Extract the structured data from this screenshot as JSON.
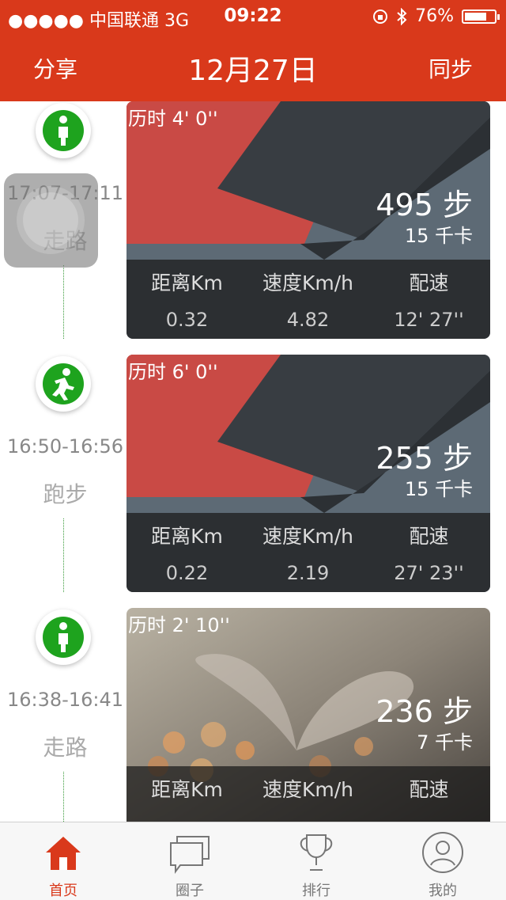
{
  "status": {
    "carrier": "●●●●● 中国联通 3G",
    "time": "09:22",
    "battery": "76%",
    "battery_level": 0.76
  },
  "header": {
    "share": "分享",
    "title": "12月27日",
    "sync": "同步"
  },
  "activities": [
    {
      "icon": "walking-icon",
      "time_range": "17:07-17:11",
      "type": "走路",
      "duration": "历时 4' 0''",
      "steps": "495 步",
      "calories": "15 千卡",
      "stat_headers": [
        "距离Km",
        "速度Km/h",
        "配速"
      ],
      "stat_values": [
        "0.32",
        "4.82",
        "12' 27''"
      ]
    },
    {
      "icon": "running-icon",
      "time_range": "16:50-16:56",
      "type": "跑步",
      "duration": "历时 6' 0''",
      "steps": "255 步",
      "calories": "15 千卡",
      "stat_headers": [
        "距离Km",
        "速度Km/h",
        "配速"
      ],
      "stat_values": [
        "0.22",
        "2.19",
        "27' 23''"
      ]
    },
    {
      "icon": "walking-icon",
      "time_range": "16:38-16:41",
      "type": "走路",
      "duration": "历时 2' 10''",
      "steps": "236 步",
      "calories": "7 千卡",
      "stat_headers": [
        "距离Km",
        "速度Km/h",
        "配速"
      ],
      "stat_values": [
        "",
        "",
        ""
      ]
    }
  ],
  "tabs": [
    {
      "label": "首页",
      "icon": "home-icon",
      "active": true
    },
    {
      "label": "圈子",
      "icon": "chat-icon",
      "active": false
    },
    {
      "label": "排行",
      "icon": "trophy-icon",
      "active": false
    },
    {
      "label": "我的",
      "icon": "profile-icon",
      "active": false
    }
  ],
  "colors": {
    "accent": "#d9391b",
    "activity_green": "#1ea31e",
    "card_red": "#c94a45",
    "card_slate": "#5d6a75",
    "card_dark": "#383d42"
  }
}
